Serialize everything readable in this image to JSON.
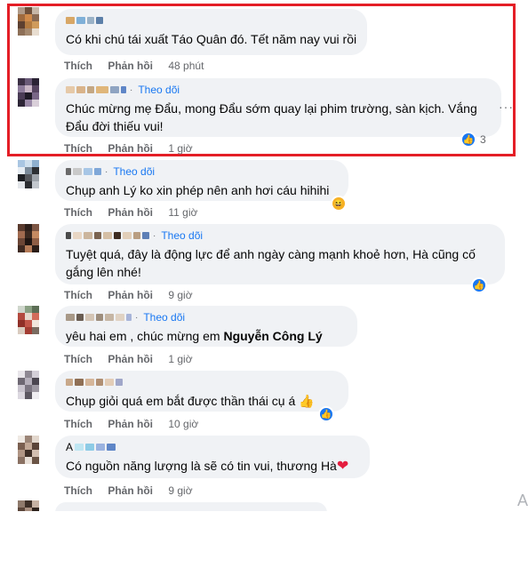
{
  "colors": {
    "highlight": "#e41e26",
    "link": "#1877f2",
    "bubble": "#f0f2f5",
    "meta": "#65676b"
  },
  "comments": [
    {
      "text": "Có khi chú tái xuất Táo Quân đó. Tết năm nay vui rồi",
      "actions": {
        "like": "Thích",
        "reply": "Phản hồi",
        "time": "48 phút"
      }
    },
    {
      "follow": "Theo dõi",
      "text": "Chúc mừng mẹ Đẩu, mong Đẩu sớm quay lại phim trường, sàn kịch. Vắng Đẩu đời thiếu vui!",
      "actions": {
        "like": "Thích",
        "reply": "Phản hồi",
        "time": "1 giờ"
      },
      "reaction_count": "3",
      "reaction_icon": "like-icon"
    },
    {
      "follow": "Theo dõi",
      "text": "Chụp anh Lý ko xin phép nên anh hơi cáu hihihi",
      "actions": {
        "like": "Thích",
        "reply": "Phản hồi",
        "time": "11 giờ"
      },
      "reaction_icon": "haha-icon"
    },
    {
      "follow": "Theo dõi",
      "text": "Tuyệt quá, đây là động lực để anh ngày càng mạnh khoẻ hơn, Hà cũng cố gắng lên nhé!",
      "actions": {
        "like": "Thích",
        "reply": "Phản hồi",
        "time": "9 giờ"
      },
      "reaction_icon": "like-icon"
    },
    {
      "follow": "Theo dõi",
      "text_prefix": "yêu hai em , chúc mừng em ",
      "mention": "Nguyễn Công Lý",
      "actions": {
        "like": "Thích",
        "reply": "Phản hồi",
        "time": "1 giờ"
      }
    },
    {
      "text": "Chụp giỏi quá em bắt được thần thái cụ á",
      "emoji": "👍",
      "actions": {
        "like": "Thích",
        "reply": "Phản hồi",
        "time": "10 giờ"
      },
      "reaction_icon": "like-icon"
    },
    {
      "name_initial": "A",
      "text": "Có nguồn năng lượng là sẽ có tin vui, thương Hà",
      "emoji": "❤",
      "actions": {
        "like": "Thích",
        "reply": "Phản hồi",
        "time": "9 giờ"
      }
    }
  ],
  "options_icon": "more-dots-icon",
  "edge_glyph": "A"
}
